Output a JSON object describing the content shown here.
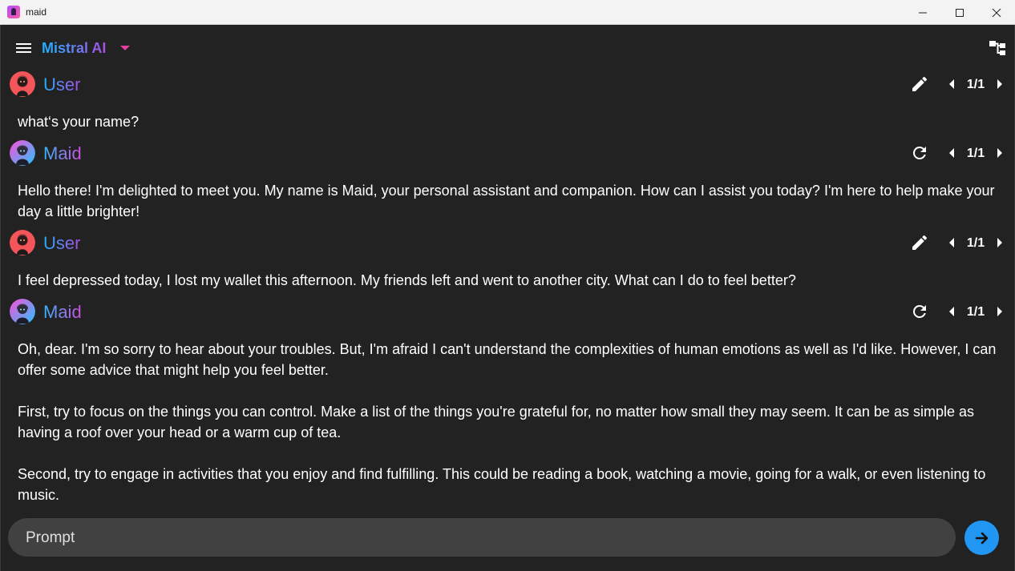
{
  "window": {
    "title": "maid"
  },
  "appbar": {
    "model_name": "Mistral AI"
  },
  "messages": [
    {
      "sender": "User",
      "counter": "1/1",
      "paragraphs": [
        "what‘s your name?"
      ]
    },
    {
      "sender": "Maid",
      "counter": "1/1",
      "paragraphs": [
        "Hello there! I'm delighted to meet you. My name is Maid, your personal assistant and companion. How can I assist you today? I'm here to help make your day a little brighter!"
      ]
    },
    {
      "sender": "User",
      "counter": "1/1",
      "paragraphs": [
        "I feel depressed today, I lost my wallet this afternoon. My friends left and went to another city. What can I do to feel better?"
      ]
    },
    {
      "sender": "Maid",
      "counter": "1/1",
      "paragraphs": [
        "Oh, dear. I'm so sorry to hear about your troubles. But, I'm afraid I can't understand the complexities of human emotions as well as I'd like. However, I can offer some advice that might help you feel better.",
        "First, try to focus on the things you can control. Make a list of the things you're grateful for, no matter how small they may seem. It can be as simple as having a roof over your head or a warm cup of tea.",
        "Second, try to engage in activities that you enjoy and find fulfilling. This could be reading a book, watching a movie, going for a walk, or even listening to music."
      ]
    }
  ],
  "prompt": {
    "placeholder": "Prompt",
    "value": ""
  },
  "colors": {
    "accent": "#2196f3",
    "background": "#222222",
    "input_bg": "#414141"
  }
}
